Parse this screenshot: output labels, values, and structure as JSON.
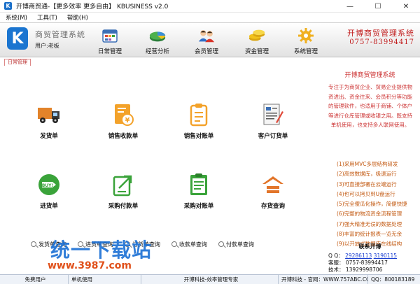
{
  "window": {
    "title": "开博商贸通-【更多效率 更多自由】    KBUSINESS v2.0",
    "app_icon_letter": "K",
    "minimize_symbol": "—",
    "maximize_symbol": "☐",
    "close_symbol": "✕"
  },
  "menu": [
    "系统(M)",
    "工具(T)",
    "帮助(H)"
  ],
  "banner": {
    "logo_letter": "K",
    "system_name": "商贸管理系统",
    "user_label": "用户:老板",
    "nav": [
      {
        "label": "日常管理",
        "icon": "calendar-icon"
      },
      {
        "label": "经营分析",
        "icon": "pie-chart-icon"
      },
      {
        "label": "会员管理",
        "icon": "users-icon"
      },
      {
        "label": "资金管理",
        "icon": "coins-icon"
      },
      {
        "label": "系统管理",
        "icon": "gear-icon"
      }
    ],
    "brand_name": "开博商贸管理系统",
    "brand_phone": "0757-83994417"
  },
  "tab": {
    "label": "日常管理"
  },
  "tiles": [
    {
      "label": "发货单",
      "icon": "truck-icon"
    },
    {
      "label": "销售收款单",
      "icon": "yen-receipt-icon"
    },
    {
      "label": "销售对账单",
      "icon": "clipboard-icon"
    },
    {
      "label": "客户订货单",
      "icon": "order-form-icon"
    },
    {
      "label": "进货单",
      "icon": "buy-tag-icon"
    },
    {
      "label": "采购付款单",
      "icon": "payment-export-icon"
    },
    {
      "label": "采购对账单",
      "icon": "checklist-icon"
    },
    {
      "label": "存货查询",
      "icon": "warehouse-icon"
    }
  ],
  "query_bar": [
    "发货单查询",
    "进货单查询",
    "订货单查询",
    "收款单查询",
    "付款单查询"
  ],
  "right_panel": {
    "title": "开博商贸管理系统",
    "description": "专注于为商贸企业、贸易企业提供物资进出、资金往来、会员积分等功能的管理软件，也适用于商铺、个体户等进行仓库管理或收银之用。既支持单机使用，也支持多人联网使用。",
    "features": [
      "(1)采用MVC多层结构研发",
      "(2)高效数据库，极速运行",
      "(3)可直接部署在云端运行",
      "(4)也可以拷贝到U盘运行",
      "(5)完全傻瓜化操作，简便快捷",
      "(6)完整的物流资金流程管理",
      "(7)强大精准无误的数据处理",
      "(8)丰富的统计报表一览无余",
      "(9)以开放式数据库在线结构"
    ],
    "contact_title": "联系开博",
    "qq_label": "Q Q：",
    "qq_1": "29286113",
    "qq_2": "3190115",
    "service_label": "客服：",
    "service_phone": "0757-83994417",
    "tech_label": "技术：",
    "tech_phone": "13929998706"
  },
  "watermark": {
    "text": "统一下载站",
    "url": "www.3987.com"
  },
  "statusbar": [
    "免费用户",
    "单机使用",
    "开博科技-效率管理专家",
    "开博科技 - 官网：WWW.757ABC.COM",
    "QQ：800183189"
  ],
  "colors": {
    "accent_red": "#c33333",
    "feature_orange": "#c35b14",
    "logo_blue": "#1b75d0",
    "icon_orange": "#f3a22a",
    "icon_green": "#3aa33a",
    "icon_yellow": "#f2c21a"
  }
}
